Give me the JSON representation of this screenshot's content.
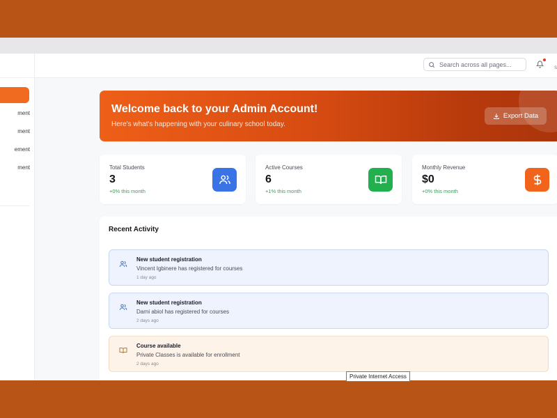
{
  "topbar": {
    "search_placeholder": "Search across all pages...",
    "user_initial": "S"
  },
  "sidebar": {
    "items": [
      {
        "label": "ment"
      },
      {
        "label": "ment"
      },
      {
        "label": "ement"
      },
      {
        "label": "ment"
      }
    ]
  },
  "banner": {
    "title": "Welcome back to your Admin Account!",
    "subtitle": "Here's what's happening with your culinary school today.",
    "export_label": "Export Data"
  },
  "stats": [
    {
      "label": "Total Students",
      "value": "3",
      "change": "+0% this month",
      "icon": "users-icon",
      "color": "#3a73e6"
    },
    {
      "label": "Active Courses",
      "value": "6",
      "change": "+1% this month",
      "icon": "book-icon",
      "color": "#22b04f"
    },
    {
      "label": "Monthly Revenue",
      "value": "$0",
      "change": "+0% this month",
      "icon": "dollar-icon",
      "color": "#f0641c"
    }
  ],
  "activity": {
    "title": "Recent Activity",
    "items": [
      {
        "title": "New student registration",
        "desc": "Vincent Igbinere has registered for courses",
        "time": "1 day ago",
        "icon": "users-icon",
        "tone": "blue"
      },
      {
        "title": "New student registration",
        "desc": "Darni abiol has registered for courses",
        "time": "2 days ago",
        "icon": "users-icon",
        "tone": "blue"
      },
      {
        "title": "Course available",
        "desc": "Private Classes is available for enrollment",
        "time": "2 days ago",
        "icon": "book-icon",
        "tone": "orange"
      }
    ]
  },
  "tooltip": "Private Internet Access"
}
